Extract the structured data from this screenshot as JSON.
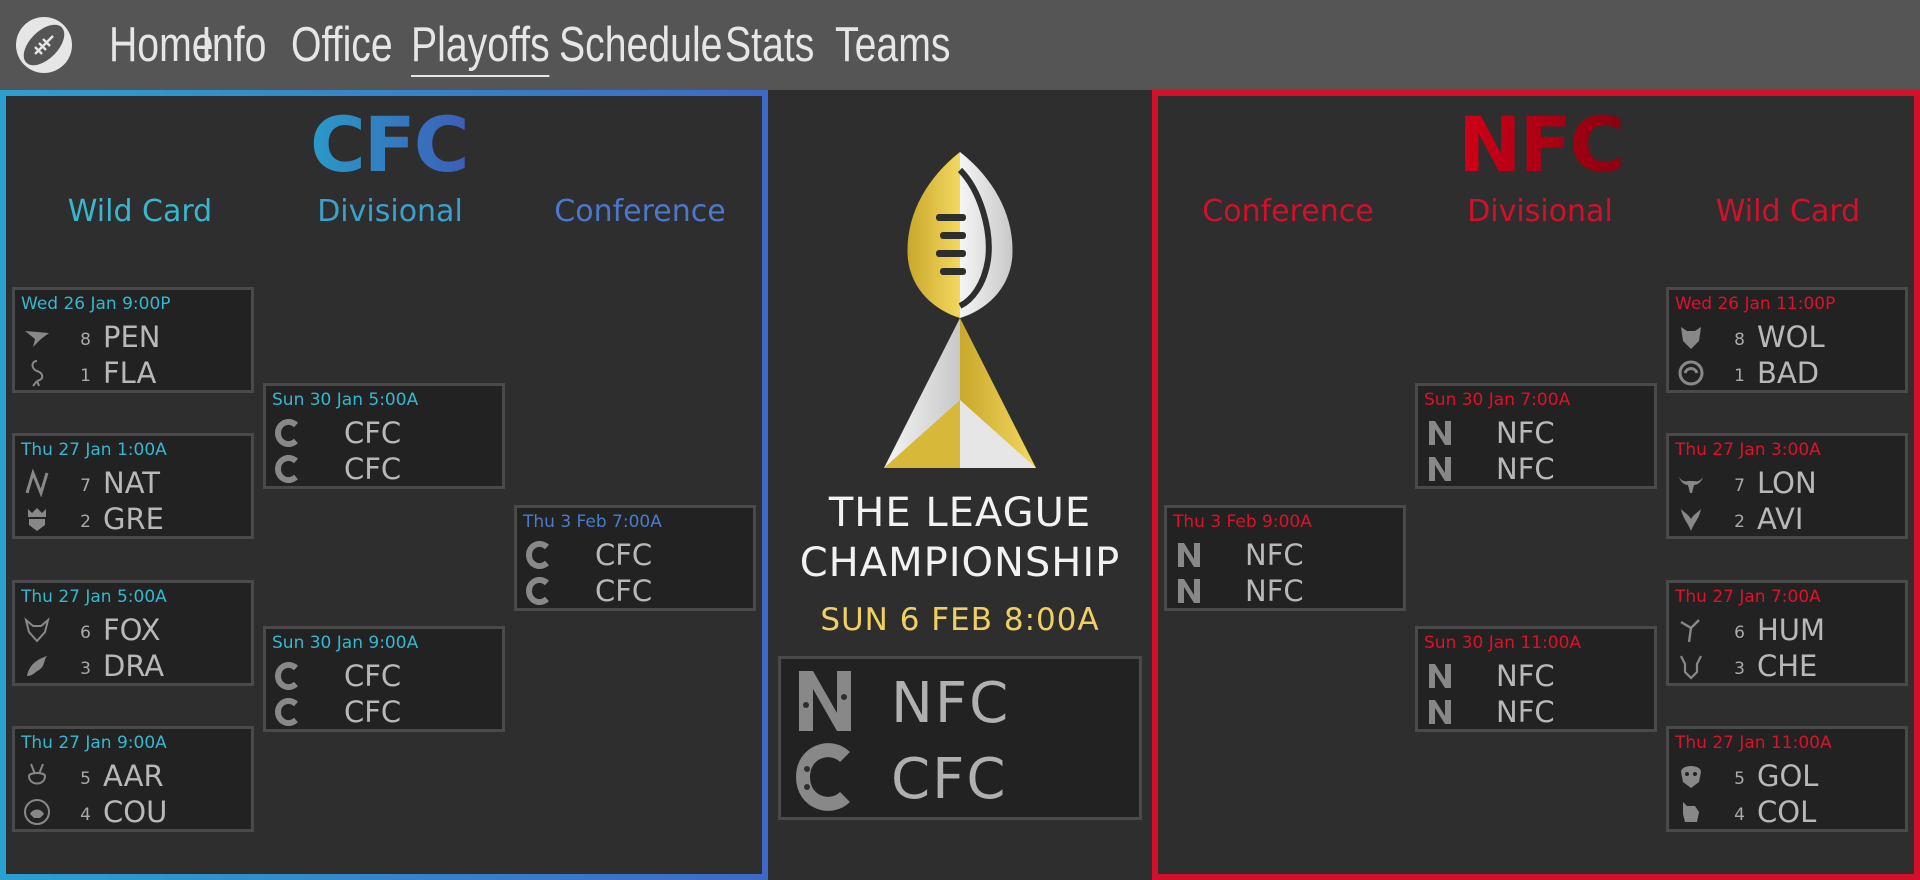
{
  "nav": {
    "logo_icon": "football-icon",
    "items": [
      {
        "label": "Home",
        "active": false
      },
      {
        "label": "Info",
        "active": false
      },
      {
        "label": "Office",
        "active": false
      },
      {
        "label": "Playoffs",
        "active": true
      },
      {
        "label": "Schedule",
        "active": false
      },
      {
        "label": "Stats",
        "active": false
      },
      {
        "label": "Teams",
        "active": false
      }
    ]
  },
  "cfc": {
    "title": "CFC",
    "rounds": {
      "wild_card": "Wild Card",
      "divisional": "Divisional",
      "conference": "Conference"
    },
    "wild_card": [
      {
        "date": "Wed 26 Jan 9:00P",
        "team1": {
          "seed": "8",
          "abbr": "PEN",
          "icon": "penguin-icon"
        },
        "team2": {
          "seed": "1",
          "abbr": "FLA",
          "icon": "flamingo-icon"
        }
      },
      {
        "date": "Thu 27 Jan 1:00A",
        "team1": {
          "seed": "7",
          "abbr": "NAT",
          "icon": "nat-logo-icon"
        },
        "team2": {
          "seed": "2",
          "abbr": "GRE",
          "icon": "crown-shield-icon"
        }
      },
      {
        "date": "Thu 27 Jan 5:00A",
        "team1": {
          "seed": "6",
          "abbr": "FOX",
          "icon": "fox-icon"
        },
        "team2": {
          "seed": "3",
          "abbr": "DRA",
          "icon": "dragon-icon"
        }
      },
      {
        "date": "Thu 27 Jan 9:00A",
        "team1": {
          "seed": "5",
          "abbr": "AAR",
          "icon": "aardvark-icon"
        },
        "team2": {
          "seed": "4",
          "abbr": "COU",
          "icon": "cougar-icon"
        }
      }
    ],
    "divisional": [
      {
        "date": "Sun 30 Jan 5:00A",
        "team1": "CFC",
        "team2": "CFC"
      },
      {
        "date": "Sun 30 Jan 9:00A",
        "team1": "CFC",
        "team2": "CFC"
      }
    ],
    "conference": {
      "date": "Thu 3 Feb 7:00A",
      "team1": "CFC",
      "team2": "CFC"
    }
  },
  "nfc": {
    "title": "NFC",
    "rounds": {
      "wild_card": "Wild Card",
      "divisional": "Divisional",
      "conference": "Conference"
    },
    "wild_card": [
      {
        "date": "Wed 26 Jan 11:00P",
        "team1": {
          "seed": "8",
          "abbr": "WOL",
          "icon": "wolf-icon"
        },
        "team2": {
          "seed": "1",
          "abbr": "BAD",
          "icon": "badger-icon"
        }
      },
      {
        "date": "Thu 27 Jan 3:00A",
        "team1": {
          "seed": "7",
          "abbr": "LON",
          "icon": "longhorn-icon"
        },
        "team2": {
          "seed": "2",
          "abbr": "AVI",
          "icon": "bird-icon"
        }
      },
      {
        "date": "Thu 27 Jan 7:00A",
        "team1": {
          "seed": "6",
          "abbr": "HUM",
          "icon": "hummingbird-icon"
        },
        "team2": {
          "seed": "3",
          "abbr": "CHE",
          "icon": "cheetah-icon"
        }
      },
      {
        "date": "Thu 27 Jan 11:00A",
        "team1": {
          "seed": "5",
          "abbr": "GOL",
          "icon": "golem-icon"
        },
        "team2": {
          "seed": "4",
          "abbr": "COL",
          "icon": "collie-icon"
        }
      }
    ],
    "divisional": [
      {
        "date": "Sun 30 Jan 7:00A",
        "team1": "NFC",
        "team2": "NFC"
      },
      {
        "date": "Sun 30 Jan 11:00A",
        "team1": "NFC",
        "team2": "NFC"
      }
    ],
    "conference": {
      "date": "Thu 3 Feb 9:00A",
      "team1": "NFC",
      "team2": "NFC"
    }
  },
  "championship": {
    "trophy_icon": "trophy-icon",
    "title_line1": "THE LEAGUE",
    "title_line2": "CHAMPIONSHIP",
    "date": "SUN 6 FEB 8:00A",
    "team1": "NFC",
    "team2": "CFC"
  },
  "colors": {
    "cfc_accent": "#38b6cc",
    "nfc_accent": "#d2102a",
    "champ_date": "#f0d060",
    "nav_bg": "#555555",
    "page_bg": "#2e2e2e"
  }
}
